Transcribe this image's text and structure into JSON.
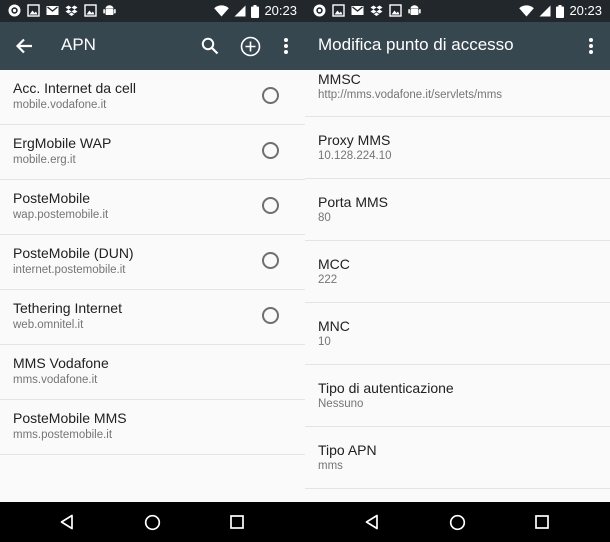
{
  "status_bar": {
    "time": "20:23"
  },
  "left": {
    "title": "APN",
    "apns": [
      {
        "name": "Acc. Internet da cell",
        "apn": "mobile.vodafone.it",
        "has_radio": true
      },
      {
        "name": "ErgMobile WAP",
        "apn": "mobile.erg.it",
        "has_radio": true
      },
      {
        "name": "PosteMobile",
        "apn": "wap.postemobile.it",
        "has_radio": true
      },
      {
        "name": "PosteMobile (DUN)",
        "apn": "internet.postemobile.it",
        "has_radio": true
      },
      {
        "name": "Tethering Internet",
        "apn": "web.omnitel.it",
        "has_radio": true
      },
      {
        "name": "MMS Vodafone",
        "apn": "mms.vodafone.it",
        "has_radio": false
      },
      {
        "name": "PosteMobile MMS",
        "apn": "mms.postemobile.it",
        "has_radio": false
      }
    ]
  },
  "right": {
    "title": "Modifica punto di accesso",
    "fields": [
      {
        "label": "MMSC",
        "value": "http://mms.vodafone.it/servlets/mms"
      },
      {
        "label": "Proxy MMS",
        "value": "10.128.224.10"
      },
      {
        "label": "Porta MMS",
        "value": "80"
      },
      {
        "label": "MCC",
        "value": "222"
      },
      {
        "label": "MNC",
        "value": "10"
      },
      {
        "label": "Tipo di autenticazione",
        "value": "Nessuno"
      },
      {
        "label": "Tipo APN",
        "value": "mms"
      }
    ]
  },
  "icons": {
    "back": "arrow-back-icon",
    "search": "search-icon",
    "add": "add-circle-icon",
    "overflow": "more-vert-icon",
    "nav_back": "nav-back-icon",
    "nav_home": "nav-home-icon",
    "nav_recents": "nav-recents-icon"
  },
  "colors": {
    "status_bar": "#21272b",
    "app_bar": "#37474f",
    "background": "#fafafa",
    "divider": "#e4e4e4"
  }
}
